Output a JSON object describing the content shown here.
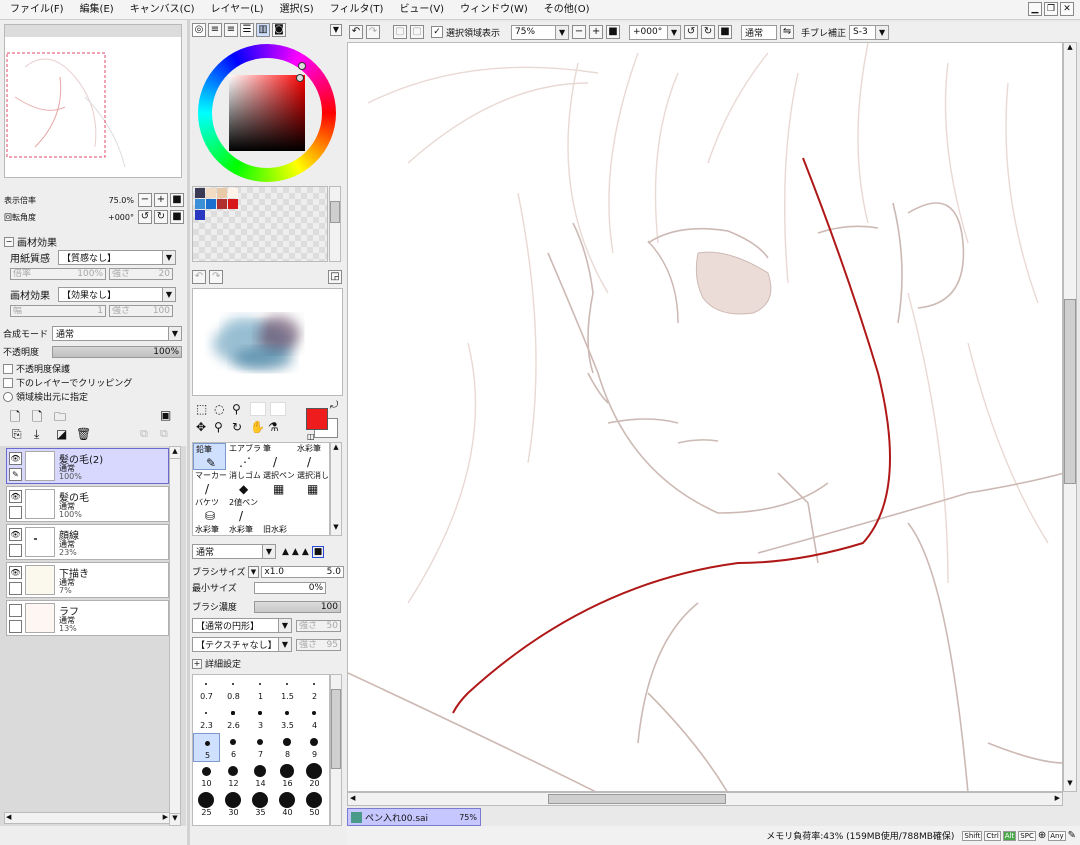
{
  "menu": [
    "ファイル(F)",
    "編集(E)",
    "キャンバス(C)",
    "レイヤー(L)",
    "選択(S)",
    "フィルタ(T)",
    "ビュー(V)",
    "ウィンドウ(W)",
    "その他(O)"
  ],
  "navigator": {
    "zoom_label": "表示倍率",
    "zoom_value": "75.0%",
    "rotate_label": "回転角度",
    "rotate_value": "+000°"
  },
  "paper_effects": {
    "header": "画材効果",
    "texture_label": "用紙質感",
    "texture_value": "【質感なし】",
    "texture_scale_label": "倍率",
    "texture_scale_value": "100%",
    "texture_strength_label": "強さ",
    "texture_strength_value": "20",
    "effect_label": "画材効果",
    "effect_value": "【効果なし】",
    "effect_width_label": "幅",
    "effect_width_value": "1",
    "effect_strength_label": "強さ",
    "effect_strength_value": "100"
  },
  "layer_props": {
    "blend_label": "合成モード",
    "blend_value": "通常",
    "opacity_label": "不透明度",
    "opacity_value": "100%",
    "opacity_fraction": 1.0,
    "protect_opacity": "不透明度保護",
    "clip": "下のレイヤーでクリッピング",
    "selection_source": "領域検出元に指定"
  },
  "layers": [
    {
      "name": "髪の毛(2)",
      "mode": "通常",
      "opacity": "100%",
      "selected": true
    },
    {
      "name": "髪の毛",
      "mode": "通常",
      "opacity": "100%",
      "selected": false
    },
    {
      "name": "顔線",
      "mode": "通常",
      "opacity": "23%",
      "selected": false
    },
    {
      "name": "下描き",
      "mode": "通常",
      "opacity": "7%",
      "selected": false
    },
    {
      "name": "ラフ",
      "mode": "通常",
      "opacity": "13%",
      "selected": false
    }
  ],
  "palette_colors": [
    "#3a3a55",
    "#f2ddc4",
    "#e8c9a8",
    "#fff4ea",
    "#3a8fd6",
    "#1a6fcf",
    "#b03030",
    "#d81818",
    "#2a3ac0"
  ],
  "colors": {
    "primary": "#ee1c1c",
    "secondary": "#ffffff",
    "stroke": "#b01818"
  },
  "tools": [
    {
      "label": "鉛筆",
      "icon": "✎",
      "selected": true
    },
    {
      "label": "エアブラシ",
      "icon": "⋰",
      "selected": false
    },
    {
      "label": "筆",
      "icon": "/",
      "selected": false
    },
    {
      "label": "水彩筆",
      "icon": "/",
      "selected": false
    },
    {
      "label": "マーカー",
      "icon": "/",
      "selected": false
    },
    {
      "label": "消しゴム",
      "icon": "◆",
      "selected": false
    },
    {
      "label": "選択ペン",
      "icon": "▦",
      "selected": false
    },
    {
      "label": "選択消し",
      "icon": "▦",
      "selected": false
    },
    {
      "label": "バケツ",
      "icon": "⛁",
      "selected": false
    },
    {
      "label": "2値ペン",
      "icon": "/",
      "selected": false
    },
    {
      "label": "",
      "icon": "",
      "selected": false
    },
    {
      "label": "",
      "icon": "",
      "selected": false
    },
    {
      "label": "水彩筆",
      "icon": "",
      "selected": false
    },
    {
      "label": "水彩筆",
      "icon": "",
      "selected": false
    },
    {
      "label": "旧水彩",
      "icon": "",
      "selected": false
    }
  ],
  "brush": {
    "blend_value": "通常",
    "size_label": "ブラシサイズ",
    "size_mult": "x1.0",
    "size_value": "5.0",
    "min_size_label": "最小サイズ",
    "min_size_value": "0%",
    "density_label": "ブラシ濃度",
    "density_value": "100",
    "shape_value": "【通常の円形】",
    "shape_strength_label": "強さ",
    "shape_strength_value": "50",
    "texture_value": "【テクスチャなし】",
    "texture_strength_label": "強さ",
    "texture_strength_value": "95",
    "details_label": "詳細設定"
  },
  "brush_sizes": [
    "0.7",
    "0.8",
    "1",
    "1.5",
    "2",
    "2.3",
    "2.6",
    "3",
    "3.5",
    "4",
    "5",
    "6",
    "7",
    "8",
    "9",
    "10",
    "12",
    "14",
    "16",
    "20",
    "25",
    "30",
    "35",
    "40",
    "50"
  ],
  "canvas_toolbar": {
    "show_selection": "選択領域表示",
    "zoom": "75%",
    "rotation": "+000°",
    "blend": "通常",
    "stabilizer_label": "手ブレ補正",
    "stabilizer_value": "S-3"
  },
  "document_tab": {
    "name": "ペン入れ00.sai",
    "zoom": "75%"
  },
  "status": {
    "memory": "メモリ負荷率:43% (159MB使用/788MB確保)",
    "keys": [
      "Shift",
      "Ctrl",
      "Alt",
      "SPC",
      "Any"
    ]
  }
}
